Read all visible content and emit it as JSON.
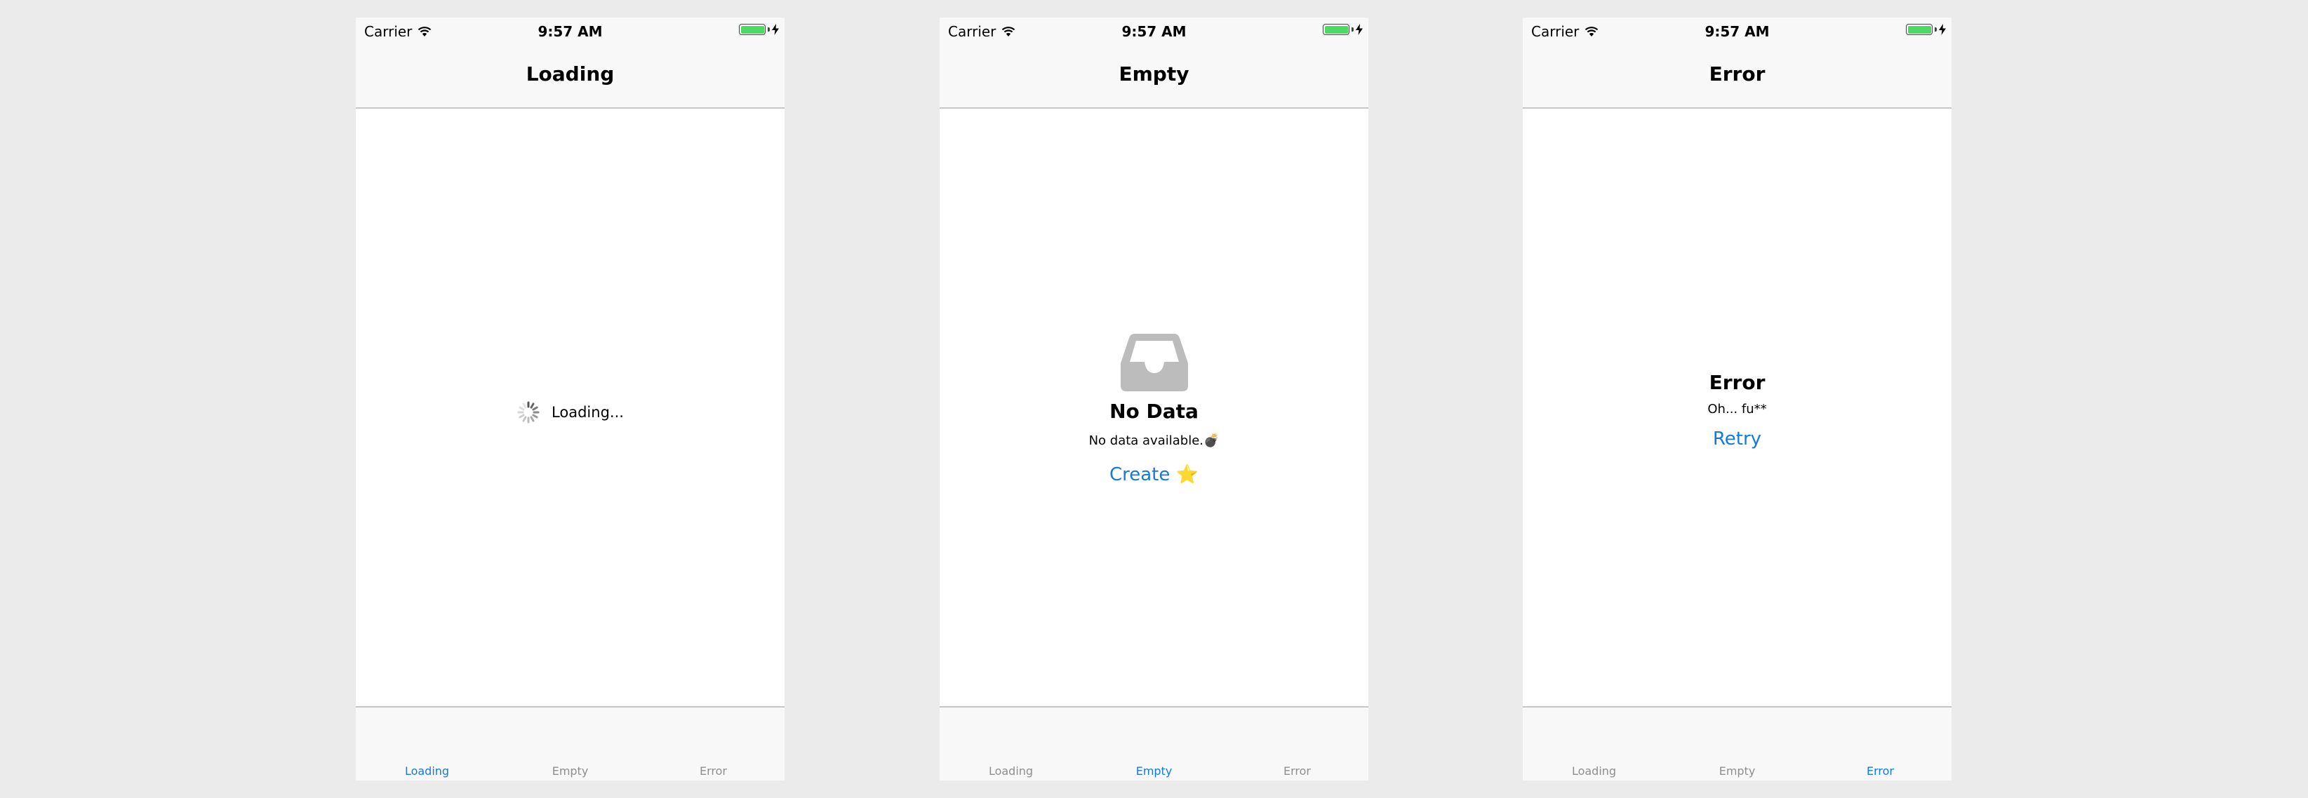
{
  "colors": {
    "accent": "#1479e0",
    "inactive_tab": "#8e8e8e",
    "battery_fill": "#4cd964",
    "icon_gray": "#bcbcbc",
    "background": "#ebebeb"
  },
  "status_bar": {
    "carrier": "Carrier",
    "time": "9:57 AM",
    "wifi_icon": "wifi-icon",
    "battery_level": 1.0,
    "charging_icon": "charging-bolt-icon"
  },
  "tab_labels": [
    "Loading",
    "Empty",
    "Error"
  ],
  "screens": [
    {
      "title": "Loading",
      "selected_tab": "Loading",
      "loading": {
        "icon": "activity-spinner-icon",
        "text": "Loading..."
      }
    },
    {
      "title": "Empty",
      "selected_tab": "Empty",
      "empty": {
        "icon": "inbox-tray-icon",
        "title": "No Data",
        "description": "No data available.💣",
        "button": "Create ⭐️"
      }
    },
    {
      "title": "Error",
      "selected_tab": "Error",
      "error": {
        "title": "Error",
        "description": "Oh... fu**",
        "button": "Retry"
      }
    }
  ]
}
